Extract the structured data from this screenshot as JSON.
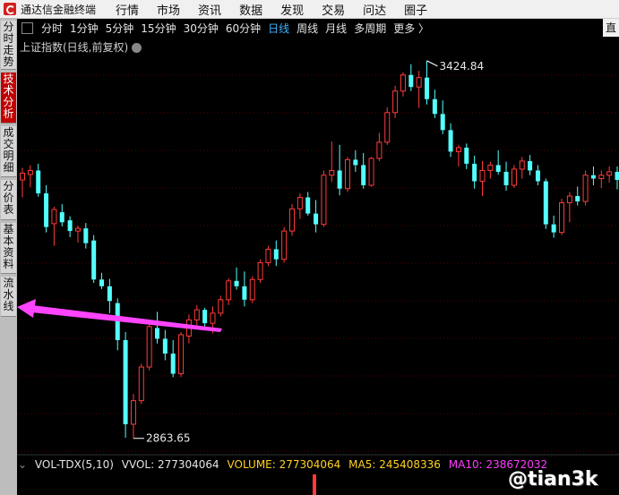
{
  "app": {
    "name": "通达信金融终端"
  },
  "menu": [
    "行情",
    "市场",
    "资讯",
    "数据",
    "发现",
    "交易",
    "问达",
    "圈子"
  ],
  "toolbar": {
    "periods": [
      "分时",
      "1分钟",
      "5分钟",
      "15分钟",
      "30分钟",
      "60分钟",
      "日线",
      "周线",
      "月线",
      "多周期",
      "更多 〉"
    ],
    "active": "日线",
    "right_button": "直"
  },
  "sidebar": {
    "tabs": [
      "分时走势",
      "技术分析",
      "成交明细",
      "分价表",
      "基本资料",
      "流水线"
    ],
    "active": "技术分析"
  },
  "chart": {
    "title": "上证指数(日线,前复权)",
    "high_label": "3424.84",
    "low_label": "2863.65"
  },
  "indicator": {
    "name": "VOL-TDX(5,10)",
    "vvol": "VVOL: 277304064",
    "volume": "VOLUME: 277304064",
    "ma5": "MA5: 245408336",
    "ma10": "MA10: 238672032"
  },
  "watermark": "@tian3k",
  "colors": {
    "up": "#ff3b3b",
    "down": "#54ffff",
    "active_period": "#3fb4ff",
    "arrow": "#ff44ff",
    "vvol": "#e6e6e6",
    "volume": "#ffd21f",
    "ma5": "#ffd21f",
    "ma10": "#ff3bff"
  },
  "chart_data": {
    "type": "candlestick",
    "y_scale": {
      "max": 3424.84,
      "min": 2863.65
    },
    "candles": [
      {
        "o": 3248,
        "h": 3266,
        "l": 3222,
        "c": 3258
      },
      {
        "o": 3256,
        "h": 3270,
        "l": 3237,
        "c": 3262
      },
      {
        "o": 3262,
        "h": 3272,
        "l": 3223,
        "c": 3228
      },
      {
        "o": 3228,
        "h": 3240,
        "l": 3170,
        "c": 3178
      },
      {
        "o": 3183,
        "h": 3208,
        "l": 3150,
        "c": 3204
      },
      {
        "o": 3200,
        "h": 3212,
        "l": 3179,
        "c": 3185
      },
      {
        "o": 3188,
        "h": 3194,
        "l": 3163,
        "c": 3172
      },
      {
        "o": 3172,
        "h": 3180,
        "l": 3155,
        "c": 3176
      },
      {
        "o": 3176,
        "h": 3184,
        "l": 3146,
        "c": 3154
      },
      {
        "o": 3158,
        "h": 3166,
        "l": 3095,
        "c": 3100
      },
      {
        "o": 3100,
        "h": 3110,
        "l": 3086,
        "c": 3090
      },
      {
        "o": 3090,
        "h": 3101,
        "l": 3050,
        "c": 3068
      },
      {
        "o": 3065,
        "h": 3072,
        "l": 2995,
        "c": 3010
      },
      {
        "o": 3010,
        "h": 3022,
        "l": 2865,
        "c": 2885
      },
      {
        "o": 2885,
        "h": 2930,
        "l": 2864,
        "c": 2920
      },
      {
        "o": 2920,
        "h": 2975,
        "l": 2915,
        "c": 2970
      },
      {
        "o": 2970,
        "h": 3035,
        "l": 2965,
        "c": 3030
      },
      {
        "o": 3028,
        "h": 3052,
        "l": 3005,
        "c": 3012
      },
      {
        "o": 3012,
        "h": 3025,
        "l": 2980,
        "c": 2990
      },
      {
        "o": 2990,
        "h": 3010,
        "l": 2955,
        "c": 2960
      },
      {
        "o": 2960,
        "h": 3022,
        "l": 2955,
        "c": 3018
      },
      {
        "o": 3016,
        "h": 3048,
        "l": 3005,
        "c": 3040
      },
      {
        "o": 3040,
        "h": 3062,
        "l": 3032,
        "c": 3055
      },
      {
        "o": 3055,
        "h": 3058,
        "l": 3030,
        "c": 3035
      },
      {
        "o": 3035,
        "h": 3060,
        "l": 3020,
        "c": 3050
      },
      {
        "o": 3050,
        "h": 3076,
        "l": 3045,
        "c": 3070
      },
      {
        "o": 3070,
        "h": 3102,
        "l": 3062,
        "c": 3098
      },
      {
        "o": 3098,
        "h": 3118,
        "l": 3085,
        "c": 3090
      },
      {
        "o": 3090,
        "h": 3112,
        "l": 3060,
        "c": 3070
      },
      {
        "o": 3070,
        "h": 3105,
        "l": 3065,
        "c": 3100
      },
      {
        "o": 3100,
        "h": 3130,
        "l": 3095,
        "c": 3125
      },
      {
        "o": 3125,
        "h": 3150,
        "l": 3120,
        "c": 3145
      },
      {
        "o": 3145,
        "h": 3158,
        "l": 3120,
        "c": 3130
      },
      {
        "o": 3130,
        "h": 3178,
        "l": 3125,
        "c": 3172
      },
      {
        "o": 3172,
        "h": 3212,
        "l": 3165,
        "c": 3205
      },
      {
        "o": 3205,
        "h": 3228,
        "l": 3190,
        "c": 3222
      },
      {
        "o": 3222,
        "h": 3230,
        "l": 3195,
        "c": 3198
      },
      {
        "o": 3198,
        "h": 3218,
        "l": 3170,
        "c": 3182
      },
      {
        "o": 3182,
        "h": 3262,
        "l": 3178,
        "c": 3255
      },
      {
        "o": 3255,
        "h": 3305,
        "l": 3245,
        "c": 3262
      },
      {
        "o": 3262,
        "h": 3300,
        "l": 3225,
        "c": 3235
      },
      {
        "o": 3235,
        "h": 3282,
        "l": 3230,
        "c": 3278
      },
      {
        "o": 3278,
        "h": 3292,
        "l": 3260,
        "c": 3270
      },
      {
        "o": 3270,
        "h": 3288,
        "l": 3235,
        "c": 3240
      },
      {
        "o": 3240,
        "h": 3282,
        "l": 3238,
        "c": 3280
      },
      {
        "o": 3280,
        "h": 3318,
        "l": 3276,
        "c": 3304
      },
      {
        "o": 3304,
        "h": 3356,
        "l": 3300,
        "c": 3348
      },
      {
        "o": 3348,
        "h": 3388,
        "l": 3340,
        "c": 3380
      },
      {
        "o": 3380,
        "h": 3408,
        "l": 3372,
        "c": 3404
      },
      {
        "o": 3404,
        "h": 3420,
        "l": 3380,
        "c": 3386
      },
      {
        "o": 3386,
        "h": 3410,
        "l": 3355,
        "c": 3400
      },
      {
        "o": 3400,
        "h": 3425,
        "l": 3360,
        "c": 3368
      },
      {
        "o": 3368,
        "h": 3382,
        "l": 3340,
        "c": 3346
      },
      {
        "o": 3346,
        "h": 3366,
        "l": 3316,
        "c": 3322
      },
      {
        "o": 3322,
        "h": 3332,
        "l": 3282,
        "c": 3290
      },
      {
        "o": 3290,
        "h": 3300,
        "l": 3268,
        "c": 3296
      },
      {
        "o": 3296,
        "h": 3302,
        "l": 3264,
        "c": 3272
      },
      {
        "o": 3272,
        "h": 3284,
        "l": 3235,
        "c": 3246
      },
      {
        "o": 3246,
        "h": 3276,
        "l": 3224,
        "c": 3262
      },
      {
        "o": 3262,
        "h": 3275,
        "l": 3250,
        "c": 3270
      },
      {
        "o": 3270,
        "h": 3292,
        "l": 3256,
        "c": 3260
      },
      {
        "o": 3260,
        "h": 3275,
        "l": 3232,
        "c": 3240
      },
      {
        "o": 3240,
        "h": 3270,
        "l": 3236,
        "c": 3264
      },
      {
        "o": 3264,
        "h": 3282,
        "l": 3250,
        "c": 3276
      },
      {
        "o": 3276,
        "h": 3285,
        "l": 3255,
        "c": 3262
      },
      {
        "o": 3262,
        "h": 3270,
        "l": 3240,
        "c": 3246
      },
      {
        "o": 3246,
        "h": 3250,
        "l": 3175,
        "c": 3182
      },
      {
        "o": 3182,
        "h": 3195,
        "l": 3162,
        "c": 3170
      },
      {
        "o": 3170,
        "h": 3220,
        "l": 3166,
        "c": 3214
      },
      {
        "o": 3214,
        "h": 3230,
        "l": 3185,
        "c": 3224
      },
      {
        "o": 3224,
        "h": 3238,
        "l": 3210,
        "c": 3216
      },
      {
        "o": 3216,
        "h": 3262,
        "l": 3210,
        "c": 3255
      },
      {
        "o": 3255,
        "h": 3268,
        "l": 3240,
        "c": 3250
      },
      {
        "o": 3250,
        "h": 3262,
        "l": 3236,
        "c": 3255
      },
      {
        "o": 3255,
        "h": 3268,
        "l": 3244,
        "c": 3260
      },
      {
        "o": 3260,
        "h": 3268,
        "l": 3234,
        "c": 3248
      }
    ]
  }
}
